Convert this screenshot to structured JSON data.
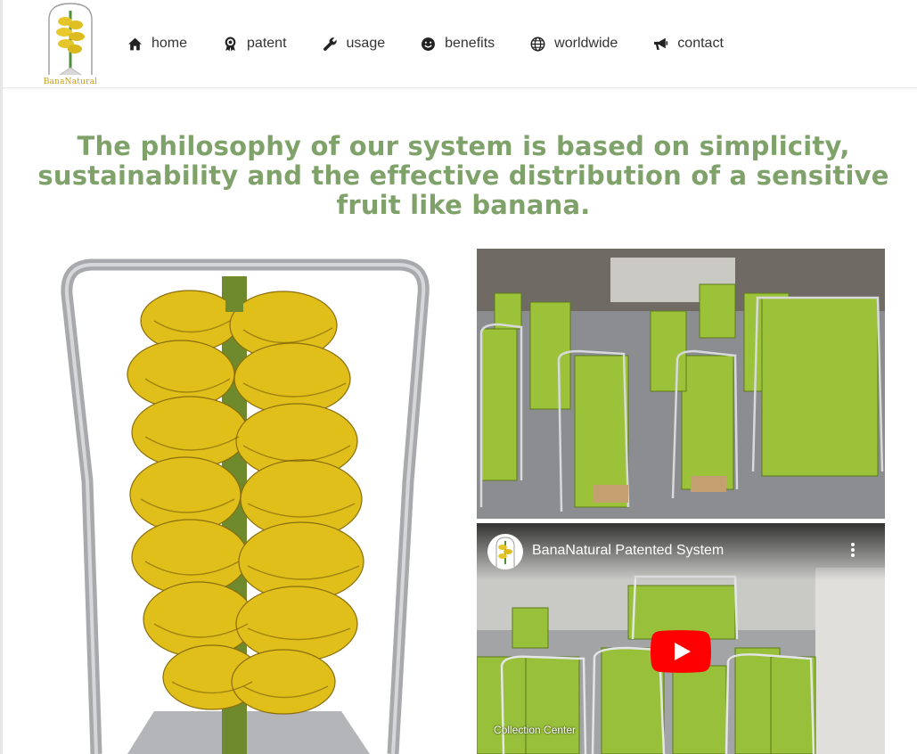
{
  "brand": {
    "logo_text": "BanaNatural"
  },
  "nav": {
    "items": [
      {
        "label": "home",
        "icon": "home-icon"
      },
      {
        "label": "patent",
        "icon": "award-ribbon-icon"
      },
      {
        "label": "usage",
        "icon": "wrench-icon"
      },
      {
        "label": "benefits",
        "icon": "smiley-icon"
      },
      {
        "label": "worldwide",
        "icon": "globe-icon"
      },
      {
        "label": "contact",
        "icon": "megaphone-icon"
      }
    ]
  },
  "main": {
    "headline": "The philosophy of our system is based on simplicity, sustainability and the effective distribution of a sensitive fruit like banana."
  },
  "video": {
    "title": "BanaNatural Patented System",
    "caption": "Collection Center",
    "play_color": "#ff0000"
  },
  "colors": {
    "headline": "#7fa16a",
    "banana_yellow": "#e2c21a",
    "banana_green": "#9fc13a",
    "frame_metal": "#a7a9ac"
  }
}
